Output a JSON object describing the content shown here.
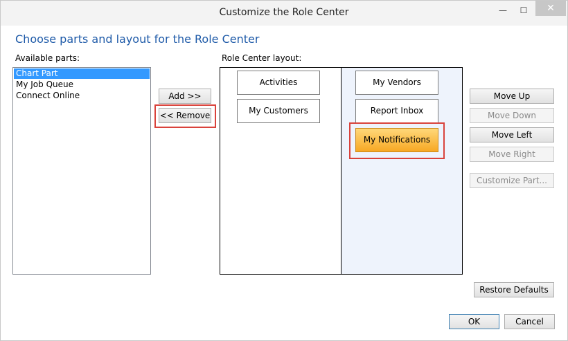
{
  "window": {
    "title": "Customize the Role Center",
    "min_glyph": "—",
    "max_glyph": "☐",
    "close_glyph": "✕"
  },
  "heading": "Choose parts and layout for the Role Center",
  "available_parts": {
    "label": "Available parts:",
    "items": [
      "Chart Part",
      "My Job Queue",
      "Connect Online"
    ],
    "selected_index": 0
  },
  "transfer": {
    "add_label": "Add >>",
    "remove_label": "<< Remove"
  },
  "role_center_layout": {
    "label": "Role Center layout:",
    "column1": [
      "Activities",
      "My Customers"
    ],
    "column2": [
      "My Vendors",
      "Report Inbox",
      "My Notifications"
    ],
    "selected_part": "My Notifications"
  },
  "actions": {
    "move_up": "Move Up",
    "move_down": "Move Down",
    "move_left": "Move Left",
    "move_right": "Move Right",
    "customize_part": "Customize Part...",
    "restore_defaults": "Restore Defaults"
  },
  "footer": {
    "ok": "OK",
    "cancel": "Cancel"
  },
  "colors": {
    "heading": "#1e5aa8",
    "selection": "#3399ff",
    "highlight": "#d9423b",
    "active_part": "#f7a823"
  }
}
